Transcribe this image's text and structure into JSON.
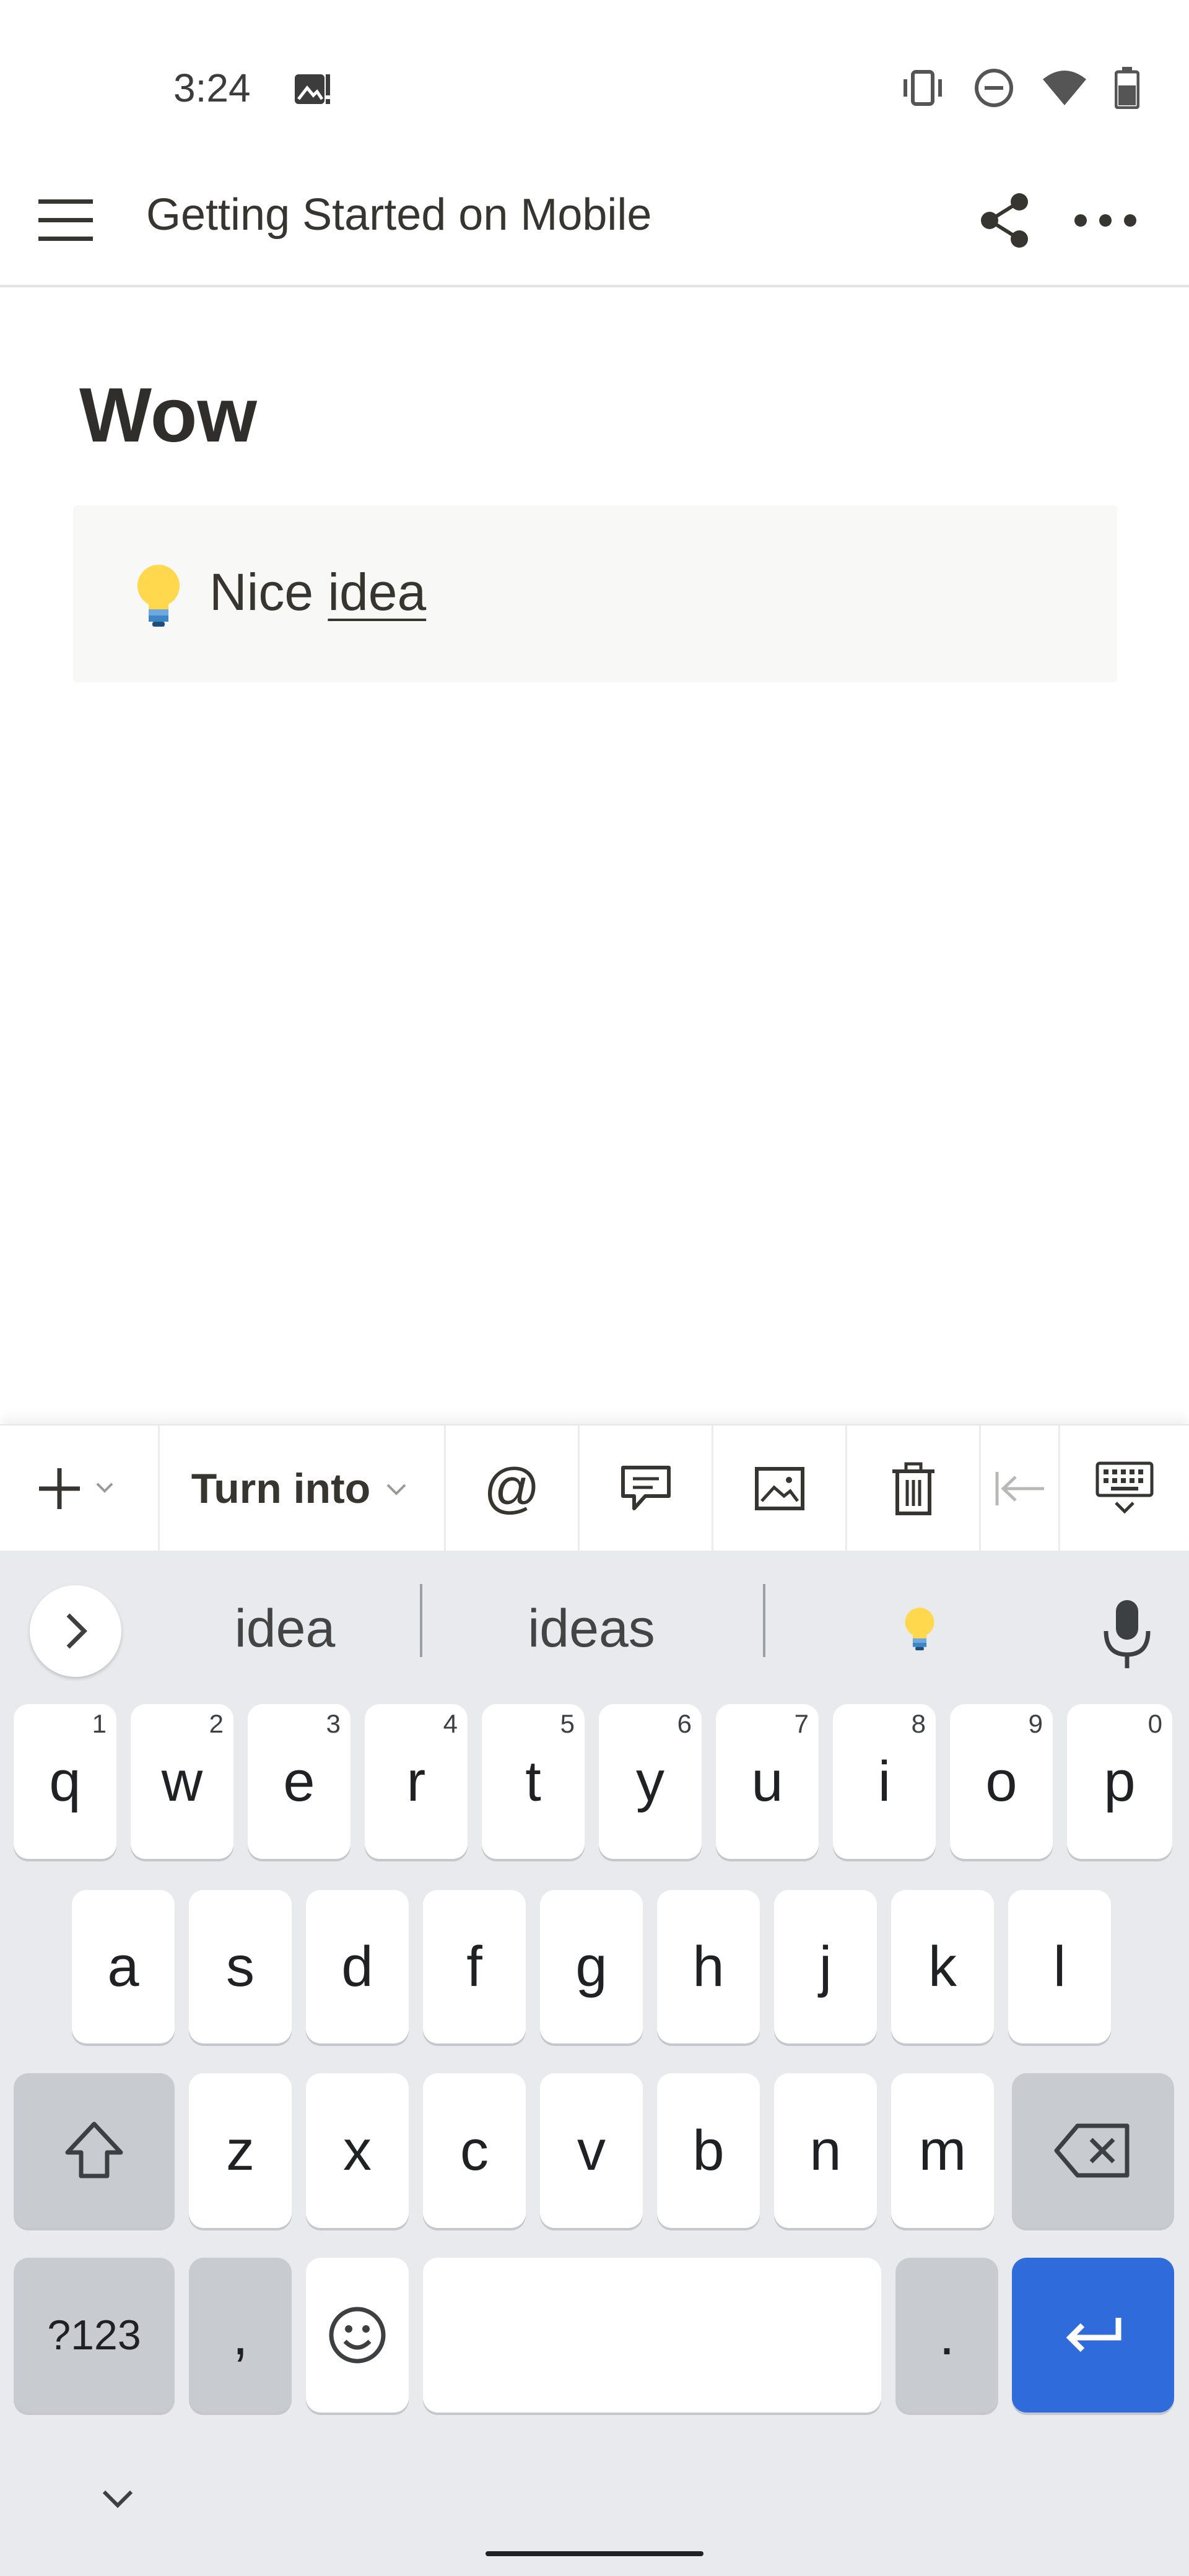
{
  "status_bar": {
    "time": "3:24",
    "icons": [
      "gallery-alert-icon",
      "vibrate-icon",
      "do-not-disturb-icon",
      "wifi-icon",
      "battery-icon"
    ]
  },
  "app_bar": {
    "title": "Getting Started on Mobile",
    "icons": [
      "menu-icon",
      "share-icon",
      "more-icon"
    ]
  },
  "page": {
    "heading": "Wow",
    "callout": {
      "emoji": "lightbulb-icon",
      "text_prefix": "Nice ",
      "text_underlined": "idea"
    }
  },
  "toolbar": {
    "add_icon": "plus-icon",
    "turn_into": "Turn into",
    "mention": "@",
    "buttons": [
      "comment-icon",
      "image-icon",
      "trash-icon",
      "outdent-icon",
      "hide-keyboard-icon"
    ]
  },
  "keyboard": {
    "suggestions": [
      "idea",
      "ideas",
      "lightbulb-icon"
    ],
    "row1": [
      {
        "key": "q",
        "hint": "1"
      },
      {
        "key": "w",
        "hint": "2"
      },
      {
        "key": "e",
        "hint": "3"
      },
      {
        "key": "r",
        "hint": "4"
      },
      {
        "key": "t",
        "hint": "5"
      },
      {
        "key": "y",
        "hint": "6"
      },
      {
        "key": "u",
        "hint": "7"
      },
      {
        "key": "i",
        "hint": "8"
      },
      {
        "key": "o",
        "hint": "9"
      },
      {
        "key": "p",
        "hint": "0"
      }
    ],
    "row2": [
      "a",
      "s",
      "d",
      "f",
      "g",
      "h",
      "j",
      "k",
      "l"
    ],
    "row3": [
      "z",
      "x",
      "c",
      "v",
      "b",
      "n",
      "m"
    ],
    "symbols_label": "?123",
    "comma": ",",
    "period": ".",
    "accent_color": "#2f6bdb"
  }
}
